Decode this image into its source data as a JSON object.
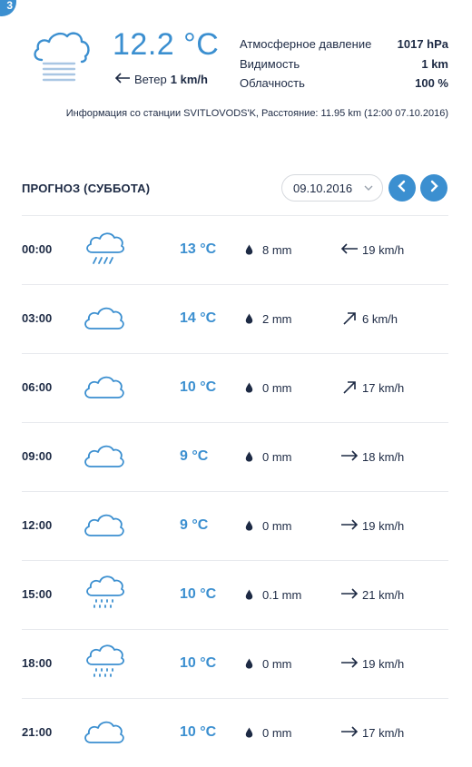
{
  "corner_badge": "3",
  "current": {
    "icon": "cloud-fog-icon",
    "temperature": "12.2 °C",
    "wind_label": "Ветер",
    "wind_value": "1 km/h",
    "wind_direction_icon": "arrow-left-icon",
    "stats": [
      {
        "label": "Атмосферное давление",
        "value": "1017 hPa"
      },
      {
        "label": "Видимость",
        "value": "1 km"
      },
      {
        "label": "Облачность",
        "value": "100 %"
      }
    ],
    "station_info": "Информация со станции SVITLOVODS'K, Расстояние: 11.95 km (12:00 07.10.2016)"
  },
  "forecast": {
    "title": "ПРОГНОЗ (СУББОТА)",
    "date_select": "09.10.2016",
    "prev_icon": "chevron-left-icon",
    "next_icon": "chevron-right-icon",
    "rows": [
      {
        "time": "00:00",
        "icon": "cloud-rain-icon",
        "temp": "13 °C",
        "precip": "8 mm",
        "wind_icon": "arrow-left-icon",
        "wind": "19 km/h"
      },
      {
        "time": "03:00",
        "icon": "cloud-icon",
        "temp": "14 °C",
        "precip": "2 mm",
        "wind_icon": "arrow-up-right-icon",
        "wind": "6 km/h"
      },
      {
        "time": "06:00",
        "icon": "cloud-icon",
        "temp": "10 °C",
        "precip": "0 mm",
        "wind_icon": "arrow-up-right-icon",
        "wind": "17 km/h"
      },
      {
        "time": "09:00",
        "icon": "cloud-icon",
        "temp": "9 °C",
        "precip": "0 mm",
        "wind_icon": "arrow-right-icon",
        "wind": "18 km/h"
      },
      {
        "time": "12:00",
        "icon": "cloud-icon",
        "temp": "9 °C",
        "precip": "0 mm",
        "wind_icon": "arrow-right-icon",
        "wind": "19 km/h"
      },
      {
        "time": "15:00",
        "icon": "cloud-drizzle-icon",
        "temp": "10 °C",
        "precip": "0.1 mm",
        "wind_icon": "arrow-right-icon",
        "wind": "21 km/h"
      },
      {
        "time": "18:00",
        "icon": "cloud-drizzle-icon",
        "temp": "10 °C",
        "precip": "0 mm",
        "wind_icon": "arrow-right-icon",
        "wind": "19 km/h"
      },
      {
        "time": "21:00",
        "icon": "cloud-icon",
        "temp": "10 °C",
        "precip": "0 mm",
        "wind_icon": "arrow-right-icon",
        "wind": "17 km/h"
      }
    ]
  },
  "colors": {
    "accent": "#3b8fd0",
    "text": "#1d2a44",
    "divider": "#e8eaee"
  }
}
